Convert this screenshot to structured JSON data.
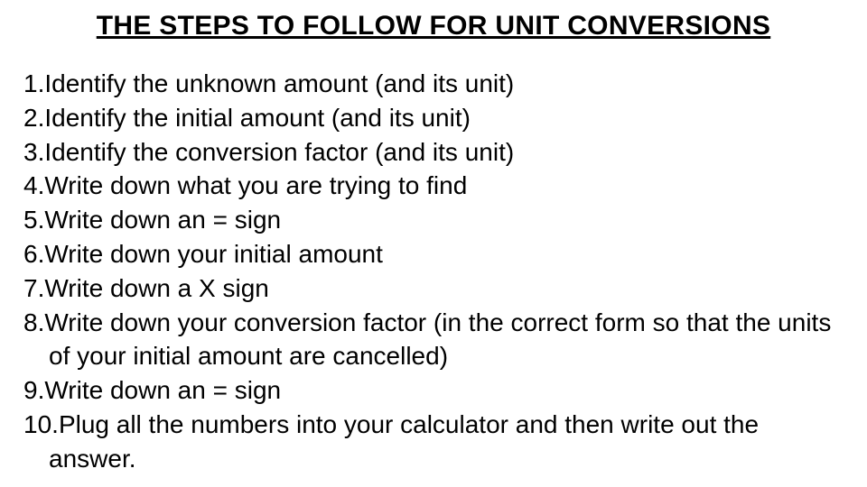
{
  "title": "THE STEPS TO FOLLOW FOR UNIT CONVERSIONS",
  "steps": [
    {
      "n": "1.",
      "text": "Identify the unknown amount (and its unit)"
    },
    {
      "n": "2.",
      "text": "Identify the initial amount (and its unit)"
    },
    {
      "n": "3.",
      "text": "Identify the conversion factor (and its unit)"
    },
    {
      "n": "4.",
      "text": "Write down what you are trying to find"
    },
    {
      "n": "5.",
      "text": "Write down an = sign"
    },
    {
      "n": "6.",
      "text": "Write down your initial amount"
    },
    {
      "n": "7.",
      "text": "Write down a X sign"
    },
    {
      "n": "8.",
      "text": "Write down your conversion factor (in the correct form so that the units of your initial amount are cancelled)"
    },
    {
      "n": "9.",
      "text": "Write down an = sign"
    },
    {
      "n": "10.",
      "text": "Plug all the numbers into your calculator and then write out the answer."
    }
  ]
}
